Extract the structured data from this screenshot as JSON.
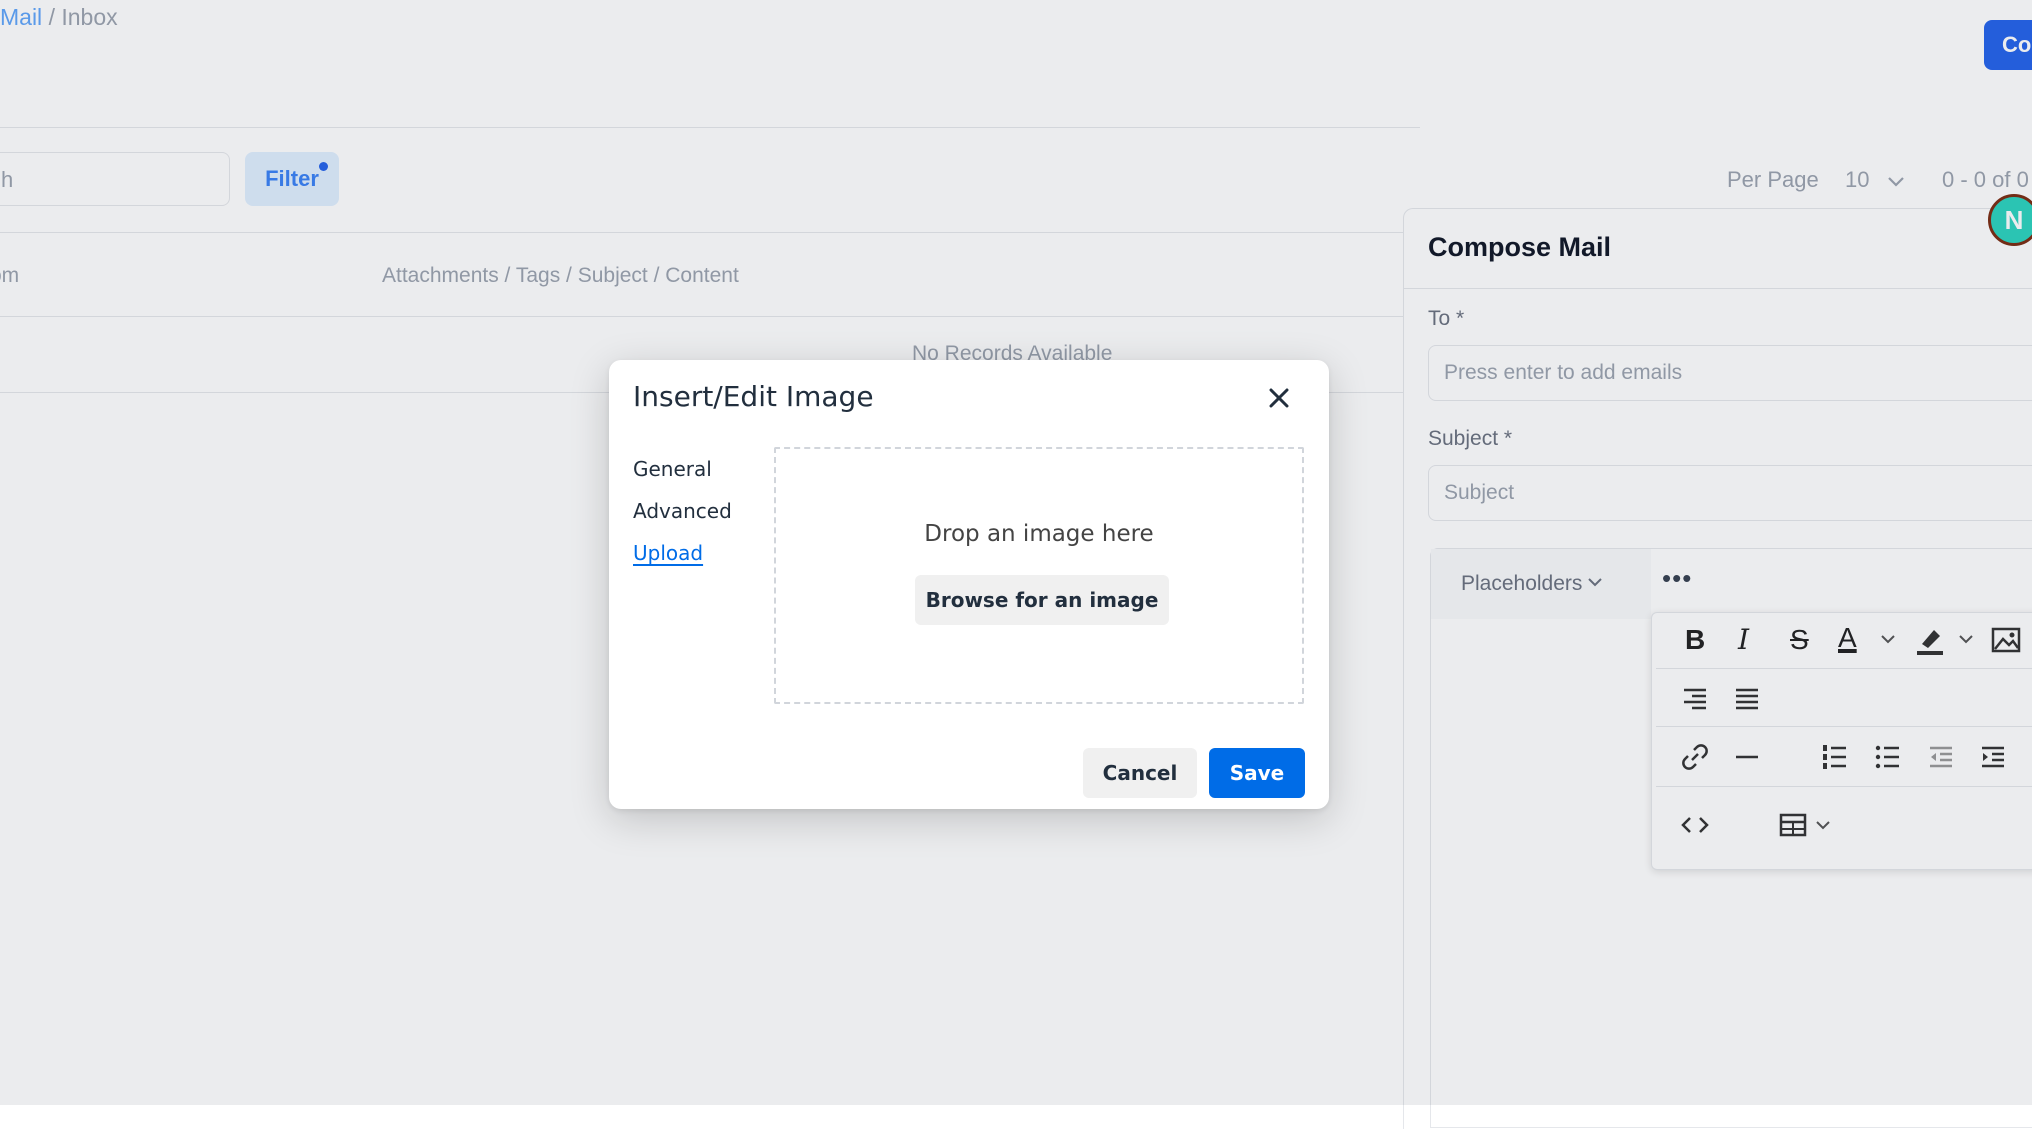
{
  "app": {
    "breadcrumb": {
      "link": "Mail",
      "separator": "/",
      "current": "Inbox"
    },
    "compose_button": "Co",
    "search_placeholder": "h",
    "filter_label": "Filter",
    "per_page_label": "Per Page",
    "per_page_value": "10",
    "range_text": "0 - 0 of 0",
    "columns": {
      "from": "om",
      "main": "Attachments / Tags / Subject / Content"
    },
    "no_records": "No Records Available"
  },
  "compose": {
    "title": "Compose Mail",
    "to_label": "To *",
    "to_placeholder": "Press enter to add emails",
    "subject_label": "Subject *",
    "subject_placeholder": "Subject",
    "placeholders_label": "Placeholders",
    "more_label": "•••",
    "toolbar": {
      "bold": "B",
      "italic": "I",
      "strike": "S",
      "text_color": "A"
    }
  },
  "avatar": {
    "initial": "N"
  },
  "dialog": {
    "title": "Insert/Edit Image",
    "tabs": [
      {
        "label": "General"
      },
      {
        "label": "Advanced"
      },
      {
        "label": "Upload"
      }
    ],
    "active_tab": "Upload",
    "drop_text": "Drop an image here",
    "browse_label": "Browse for an image",
    "cancel_label": "Cancel",
    "save_label": "Save"
  },
  "colors": {
    "primary": "#006ce7",
    "overlay": "#222f3e"
  }
}
